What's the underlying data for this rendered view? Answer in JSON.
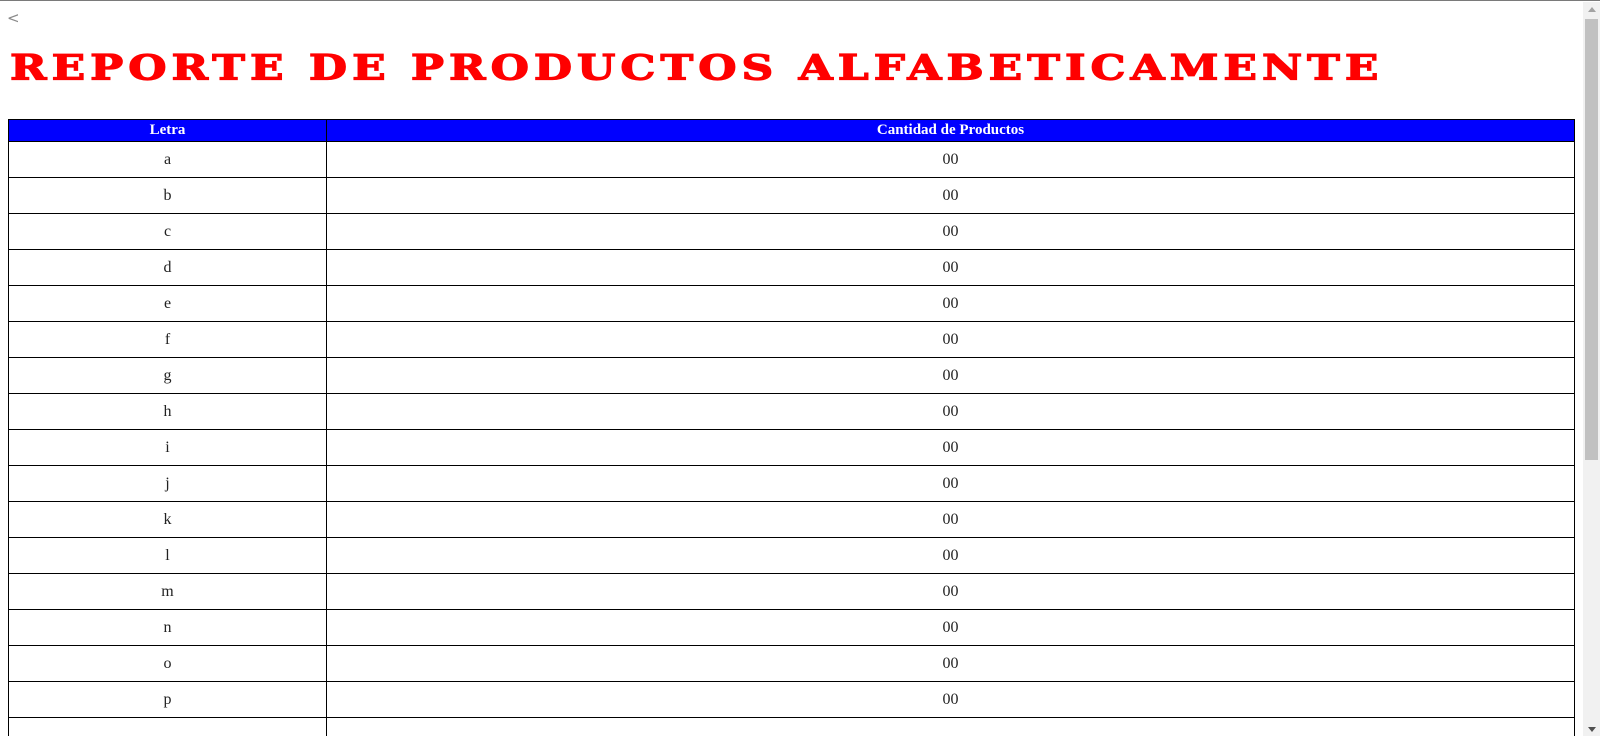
{
  "nav": {
    "back_label": "<"
  },
  "title": "REPORTE DE PRODUCTOS ALFABETICAMENTE",
  "table": {
    "headers": [
      "Letra",
      "Cantidad de Productos"
    ],
    "rows": [
      {
        "letra": "a",
        "cantidad": "00"
      },
      {
        "letra": "b",
        "cantidad": "00"
      },
      {
        "letra": "c",
        "cantidad": "00"
      },
      {
        "letra": "d",
        "cantidad": "00"
      },
      {
        "letra": "e",
        "cantidad": "00"
      },
      {
        "letra": "f",
        "cantidad": "00"
      },
      {
        "letra": "g",
        "cantidad": "00"
      },
      {
        "letra": "h",
        "cantidad": "00"
      },
      {
        "letra": "i",
        "cantidad": "00"
      },
      {
        "letra": "j",
        "cantidad": "00"
      },
      {
        "letra": "k",
        "cantidad": "00"
      },
      {
        "letra": "l",
        "cantidad": "00"
      },
      {
        "letra": "m",
        "cantidad": "00"
      },
      {
        "letra": "n",
        "cantidad": "00"
      },
      {
        "letra": "o",
        "cantidad": "00"
      },
      {
        "letra": "p",
        "cantidad": "00"
      },
      {
        "letra": "",
        "cantidad": ""
      }
    ]
  },
  "colors": {
    "title": "#ff0000",
    "header_background": "#0000ff",
    "header_text": "#ffffff"
  },
  "icons": {
    "back": "chevron-left-icon",
    "scroll_up": "scroll-up-arrow-icon",
    "scroll_down": "scroll-down-arrow-icon"
  }
}
